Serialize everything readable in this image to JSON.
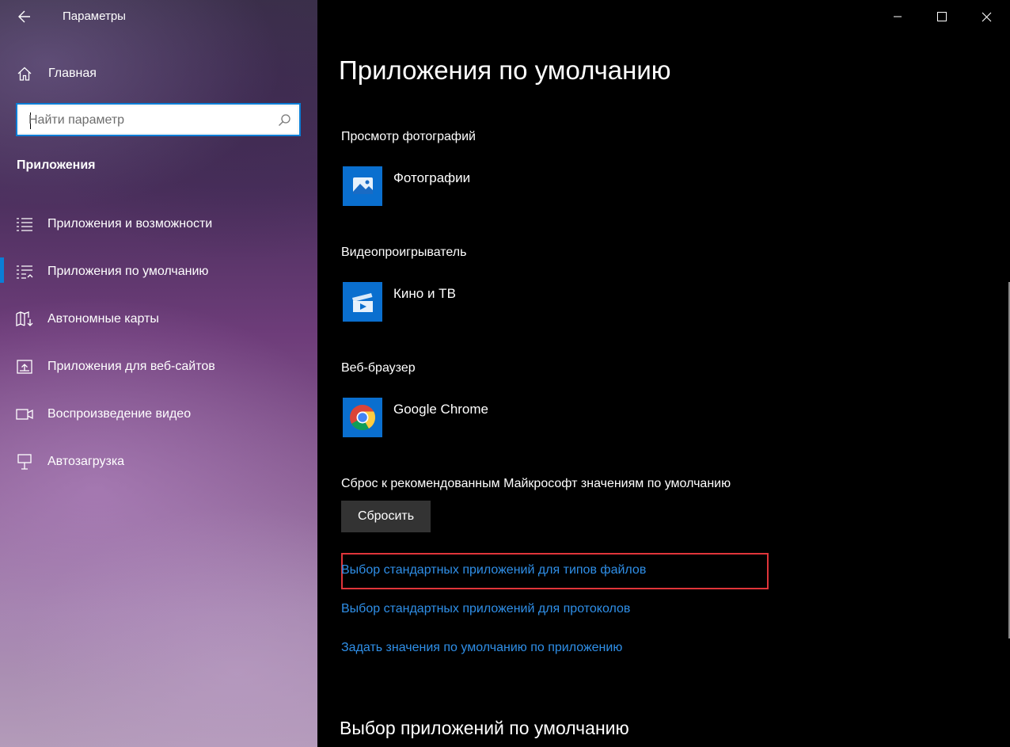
{
  "window": {
    "title": "Параметры",
    "controls": [
      "minimize",
      "maximize",
      "close"
    ]
  },
  "sidebar": {
    "home_label": "Главная",
    "search_placeholder": "Найти параметр",
    "section_title": "Приложения",
    "items": [
      {
        "label": "Приложения и возможности",
        "icon": "apps-list-icon"
      },
      {
        "label": "Приложения по умолчанию",
        "icon": "default-apps-icon",
        "active": true
      },
      {
        "label": "Автономные карты",
        "icon": "map-download-icon"
      },
      {
        "label": "Приложения для веб-сайтов",
        "icon": "open-link-icon"
      },
      {
        "label": "Воспроизведение видео",
        "icon": "video-camera-icon"
      },
      {
        "label": "Автозагрузка",
        "icon": "startup-icon"
      }
    ],
    "accent_color": "#0a7ed6"
  },
  "main": {
    "page_title": "Приложения по умолчанию",
    "categories": [
      {
        "label": "Просмотр фотографий",
        "app": "Фотографии",
        "icon": "photos-app-icon"
      },
      {
        "label": "Видеопроигрыватель",
        "app": "Кино и ТВ",
        "icon": "movies-tv-app-icon"
      },
      {
        "label": "Веб-браузер",
        "app": "Google Chrome",
        "icon": "chrome-app-icon"
      }
    ],
    "reset_label": "Сброс к рекомендованным Майкрософт значениям по умолчанию",
    "reset_button": "Сбросить",
    "links": [
      "Выбор стандартных приложений для типов файлов",
      "Выбор стандартных приложений для протоколов",
      "Задать значения по умолчанию по приложению"
    ],
    "highlighted_link": "Выбор стандартных приложений для типов файлов",
    "subheading": "Выбор приложений по умолчанию",
    "link_color": "#2f8fe8",
    "highlight_color": "#e0353a",
    "tile_color": "#0a6fcf"
  }
}
